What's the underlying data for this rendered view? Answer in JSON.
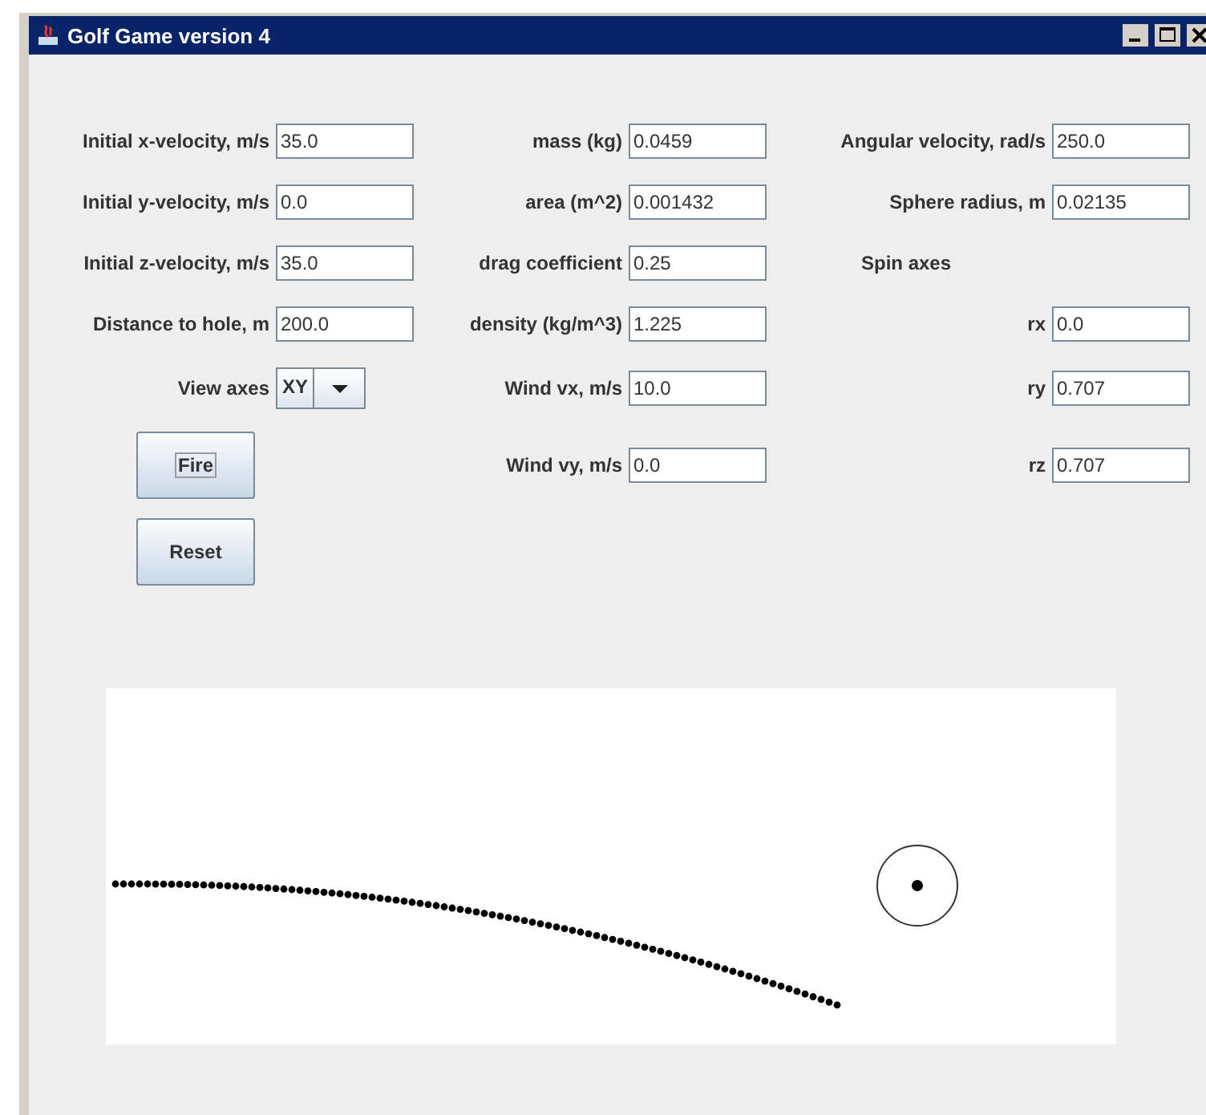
{
  "window": {
    "title": "Golf Game version 4"
  },
  "rows": [
    [
      {
        "kind": "field",
        "label": "Initial x-velocity, m/s",
        "value": "35.0"
      },
      {
        "kind": "field",
        "label": "mass (kg)",
        "value": "0.0459"
      },
      {
        "kind": "field",
        "label": "Angular velocity, rad/s",
        "value": "250.0"
      }
    ],
    [
      {
        "kind": "field",
        "label": "Initial y-velocity, m/s",
        "value": "0.0"
      },
      {
        "kind": "field",
        "label": "area (m^2)",
        "value": "0.001432"
      },
      {
        "kind": "field",
        "label": "Sphere radius, m",
        "value": "0.02135"
      }
    ],
    [
      {
        "kind": "field",
        "label": "Initial z-velocity, m/s",
        "value": "35.0"
      },
      {
        "kind": "field",
        "label": "drag coefficient",
        "value": "0.25"
      },
      {
        "kind": "heading",
        "label": "Spin axes"
      }
    ],
    [
      {
        "kind": "field",
        "label": "Distance to hole, m",
        "value": "200.0"
      },
      {
        "kind": "field",
        "label": "density (kg/m^3)",
        "value": "1.225"
      },
      {
        "kind": "field",
        "label": "rx",
        "value": "0.0"
      }
    ],
    [
      {
        "kind": "select",
        "label": "View axes",
        "value": "XY"
      },
      {
        "kind": "field",
        "label": "Wind vx, m/s",
        "value": "10.0"
      },
      {
        "kind": "field",
        "label": "ry",
        "value": "0.707"
      }
    ],
    [
      {
        "kind": "button",
        "label": "Fire",
        "focused": true
      },
      {
        "kind": "field",
        "label": "Wind vy, m/s",
        "value": "0.0"
      },
      {
        "kind": "field",
        "label": "rz",
        "value": "0.707"
      }
    ],
    [
      {
        "kind": "button",
        "label": "Reset",
        "focused": false
      },
      {
        "kind": "empty"
      },
      {
        "kind": "empty"
      }
    ]
  ]
}
